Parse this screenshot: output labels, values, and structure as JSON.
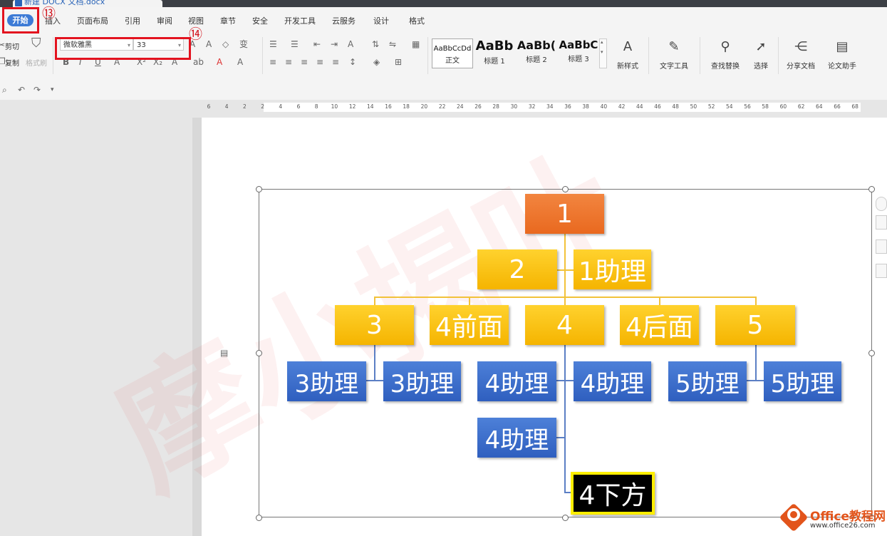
{
  "document_tab": {
    "title": "新建 DOCX 文档.docx"
  },
  "menu": {
    "start": "开始",
    "items": [
      "插入",
      "页面布局",
      "引用",
      "审阅",
      "视图",
      "章节",
      "安全",
      "开发工具",
      "云服务",
      "设计",
      "格式"
    ]
  },
  "ribbon": {
    "cut": "剪切",
    "copy": "复制",
    "format_painter": "格式刷",
    "font_name": "微软雅黑",
    "font_size": "33",
    "styles": [
      {
        "sample": "AaBbCcDd",
        "name": "正文"
      },
      {
        "sample": "AaBb",
        "name": "标题 1"
      },
      {
        "sample": "AaBb(",
        "name": "标题 2"
      },
      {
        "sample": "AaBbC",
        "name": "标题 3"
      }
    ],
    "new_style": "新样式",
    "text_tools": "文字工具",
    "find_replace": "查找替换",
    "select": "选择",
    "share_doc": "分享文档",
    "thesis_helper": "论文助手"
  },
  "ruler": {
    "ticks": [
      "6",
      "4",
      "2",
      "2",
      "4",
      "6",
      "8",
      "10",
      "12",
      "14",
      "16",
      "18",
      "20",
      "22",
      "24",
      "26",
      "28",
      "30",
      "32",
      "34",
      "36",
      "38",
      "40",
      "42",
      "44",
      "46",
      "48",
      "50",
      "52",
      "54",
      "56",
      "58",
      "60",
      "62",
      "64",
      "66",
      "68"
    ]
  },
  "annotations": {
    "step13": "⑬",
    "step14": "⑭"
  },
  "org_chart": {
    "root": "1",
    "level2": "2",
    "assistant_1": "1助理",
    "level3": [
      "3",
      "4前面",
      "4",
      "4后面",
      "5"
    ],
    "assistants": [
      "3助理",
      "3助理",
      "4助理",
      "4助理",
      "5助理",
      "5助理"
    ],
    "assistant_4_lower": "4助理",
    "below_4": "4下方"
  },
  "watermark": "摩小揭叶",
  "logo": {
    "title": "Office教程网",
    "url": "www.office26.com"
  },
  "colors": {
    "orange": "#ec722c",
    "yellow": "#fbc51b",
    "blue": "#3d6fcf",
    "highlight_border": "#ffee00",
    "callout": "#e3131f"
  }
}
